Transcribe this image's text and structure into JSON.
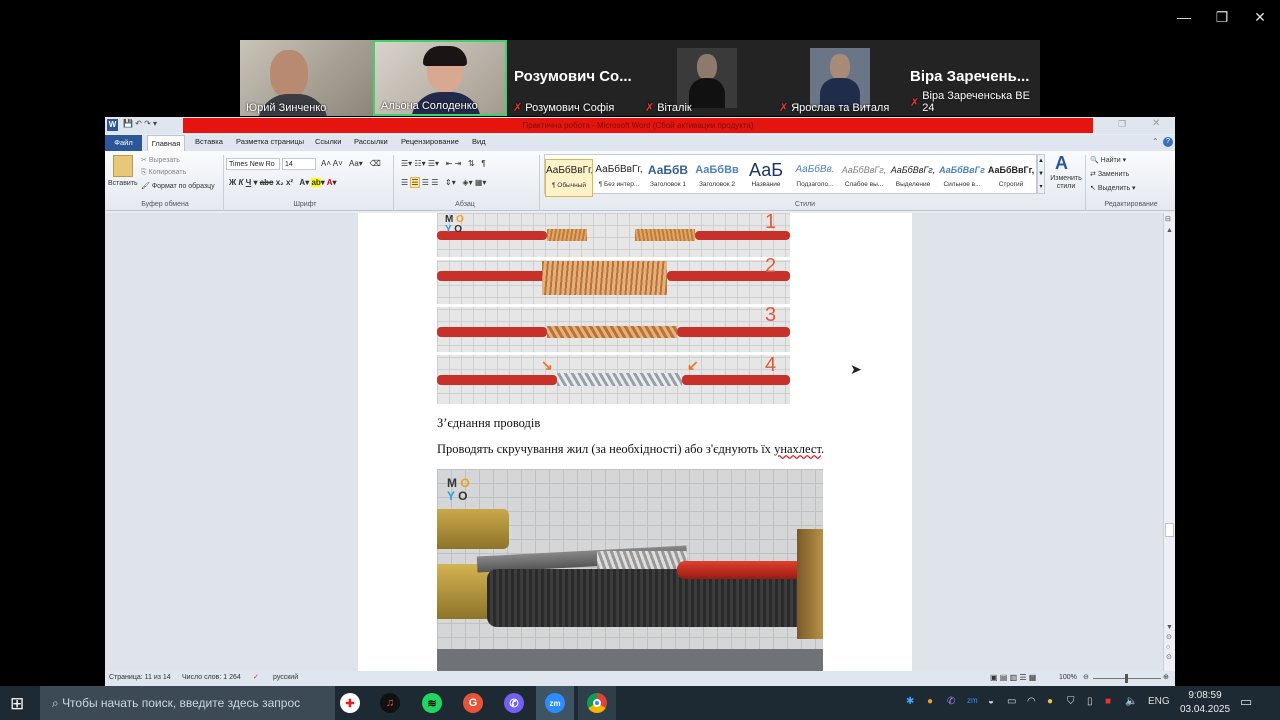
{
  "window": {
    "minimize": "—",
    "maximize": "❐",
    "close": "✕"
  },
  "video": {
    "participants": [
      {
        "name": "Юрий Зинченко"
      },
      {
        "name": "Альона Солоденко"
      },
      {
        "title": "Розумович Со...",
        "name": "Розумович Софія"
      },
      {
        "name": "Віталік"
      },
      {
        "name": "Ярослав та Виталя"
      },
      {
        "title": "Віра Заречень...",
        "name": "Віра Зареченська ВЕ 24"
      }
    ]
  },
  "word": {
    "title": "Практична робота - Microsoft Word (Сбой активации продукта)",
    "tabs": [
      "Файл",
      "Главная",
      "Вставка",
      "Разметка страницы",
      "Ссылки",
      "Рассылки",
      "Рецензирование",
      "Вид"
    ],
    "clipboard": {
      "paste": "Вставить",
      "cut": "Вырезать",
      "copy": "Копировать",
      "format": "Формат по образцу",
      "label": "Буфер обмена"
    },
    "font": {
      "name": "Times New Ro",
      "size": "14",
      "label": "Шрифт"
    },
    "paragraph": {
      "label": "Абзац"
    },
    "styles": {
      "label": "Стили",
      "items": [
        {
          "preview": "АаБбВвГг,",
          "name": "¶ Обычный"
        },
        {
          "preview": "АаБбВвГг,",
          "name": "¶ Без интер..."
        },
        {
          "preview": "АаБбВ",
          "name": "Заголовок 1"
        },
        {
          "preview": "АаБбВв",
          "name": "Заголовок 2"
        },
        {
          "preview": "АаБ",
          "name": "Название"
        },
        {
          "preview": "АаБбВв.",
          "name": "Подзаголо..."
        },
        {
          "preview": "АаБбВвГг,",
          "name": "Слабое вы..."
        },
        {
          "preview": "АаБбВвГг,",
          "name": "Выделение"
        },
        {
          "preview": "АаБбВвГг",
          "name": "Сильное в..."
        },
        {
          "preview": "АаБбВвГг,",
          "name": "Строгий"
        }
      ],
      "change": "Изменить стили"
    },
    "editing": {
      "find": "Найти",
      "replace": "Заменить",
      "select": "Выделить",
      "label": "Редактирование"
    },
    "doc": {
      "caption": "З’єднання проводів",
      "paragraph_plain": "Проводять скручування жил (за необхідності) або з'єднують їх ",
      "paragraph_marked": "унахлест",
      "paragraph_end": ".",
      "logo": [
        "M",
        "O",
        "Y",
        "O"
      ],
      "steps": [
        "1",
        "2",
        "3",
        "4"
      ]
    },
    "status": {
      "page": "Страница: 11 из 14",
      "words": "Число слов: 1 264",
      "lang": "русский",
      "zoom": "100%"
    }
  },
  "taskbar": {
    "search": "Чтобы начать поиск, введите здесь запрос",
    "lang": "ENG",
    "time": "9:08:59",
    "date": "03.04.2025"
  }
}
